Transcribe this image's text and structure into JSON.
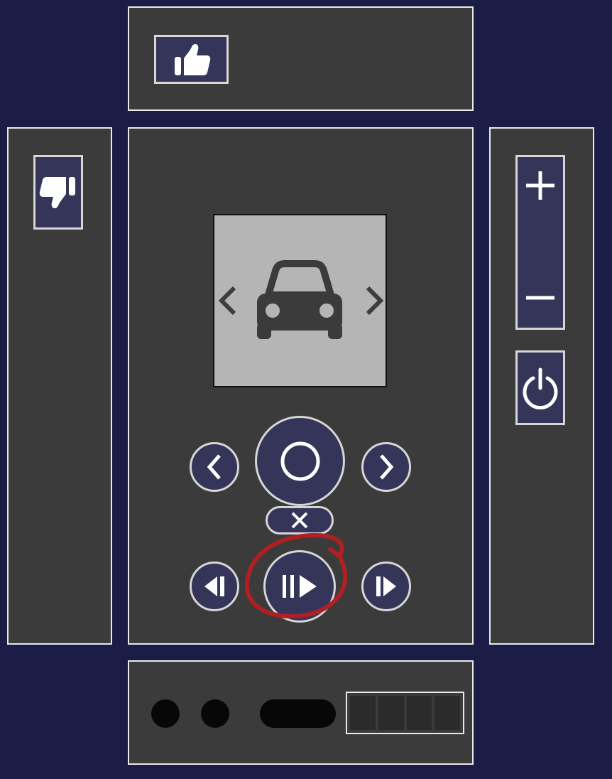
{
  "remote": {
    "top_panel": {
      "thumbs_up_icon": "thumbs-up-icon"
    },
    "left_panel": {
      "thumbs_down_icon": "thumbs-down-icon"
    },
    "center_panel": {
      "display": {
        "icon": "car-icon",
        "prev_icon": "chevron-left-icon",
        "next_icon": "chevron-right-icon",
        "background": "#b5b5b5"
      },
      "nav": {
        "left_icon": "chevron-left-icon",
        "ok_icon": "circle-icon",
        "right_icon": "chevron-right-icon",
        "back_icon": "close-icon"
      },
      "playback": {
        "rewind_icon": "skip-back-icon",
        "play_pause_icon": "play-pause-icon",
        "forward_icon": "skip-forward-icon",
        "highlight_color": "#b01f24"
      }
    },
    "right_panel": {
      "volume_up_icon": "plus-icon",
      "volume_down_icon": "minus-icon",
      "power_icon": "power-icon"
    },
    "bottom_panel": {
      "indicator_count": 2,
      "keypad_cells": 4
    }
  },
  "colors": {
    "background": "#1b1d47",
    "panel": "#3b3b3b",
    "button_fill": "#343558",
    "button_border": "#d6d6d6",
    "panel_border": "#e9e9e9"
  }
}
